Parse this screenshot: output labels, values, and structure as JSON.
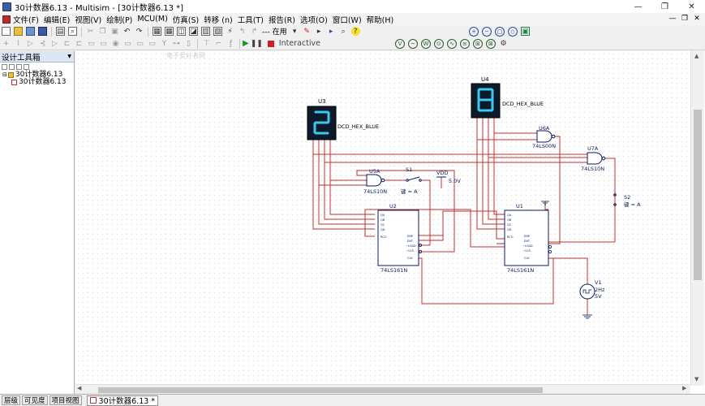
{
  "window": {
    "title": "30计数器6.13 - Multisim - [30计数器6.13 *]",
    "controls": [
      "—",
      "❐",
      "✕"
    ]
  },
  "menubar": {
    "items": [
      "文件(F)",
      "编辑(E)",
      "视图(V)",
      "绘制(P)",
      "MCU(M)",
      "仿真(S)",
      "转移 (n)",
      "工具(T)",
      "报告(R)",
      "选项(O)",
      "窗口(W)",
      "帮助(H)"
    ],
    "mdi_controls": [
      "—",
      "❐",
      "✕"
    ]
  },
  "toolbar": {
    "inuse_combo": "--- 在用",
    "interactive_label": "Interactive"
  },
  "toolbox": {
    "title": "设计工具箱",
    "pin": "▾",
    "root_item": "30计数器6.13",
    "child_item": "30计数器6.13"
  },
  "bottom": {
    "tabs": [
      "层级",
      "可见度",
      "项目视图"
    ],
    "document_tab": "30计数器6.13 *"
  },
  "schematic": {
    "watermark": "电子爱好者网",
    "colors": {
      "wire": "#c03030",
      "component": "#0a1a60",
      "grid": "#dddddd",
      "display_bg": "#0d1a2a",
      "segment_on": "#3cc8f0",
      "segment_off": "#14343f"
    },
    "displays": [
      {
        "ref": "U3",
        "part": "DCD_HEX_BLUE",
        "digit": "2"
      },
      {
        "ref": "U4",
        "part": "DCD_HEX_BLUE",
        "digit": "8"
      }
    ],
    "counters": [
      {
        "ref": "U2",
        "part": "74LS161N"
      },
      {
        "ref": "U1",
        "part": "74LS161N"
      }
    ],
    "counter_pins_left": [
      "A",
      "B",
      "C",
      "D",
      "",
      "",
      "RCO"
    ],
    "counter_pins_left_bottom": [
      "ENP",
      "ENT",
      "~LOAD",
      "~CLR",
      "CLK"
    ],
    "counter_pins_right": [
      "QA",
      "QB",
      "QC",
      "QD"
    ],
    "gates": [
      {
        "ref": "U5A",
        "part": "74LS10N"
      },
      {
        "ref": "U6A",
        "part": "74LS00N"
      },
      {
        "ref": "U7A",
        "part": "74LS10N"
      }
    ],
    "switches": [
      {
        "ref": "S1",
        "key": "键 = A"
      },
      {
        "ref": "S2",
        "key": "键 = A"
      }
    ],
    "vdd": {
      "label": "VDD",
      "value": "5.0V"
    },
    "source": {
      "ref": "V1",
      "freq": "2Hz",
      "ampl": "5V"
    }
  }
}
